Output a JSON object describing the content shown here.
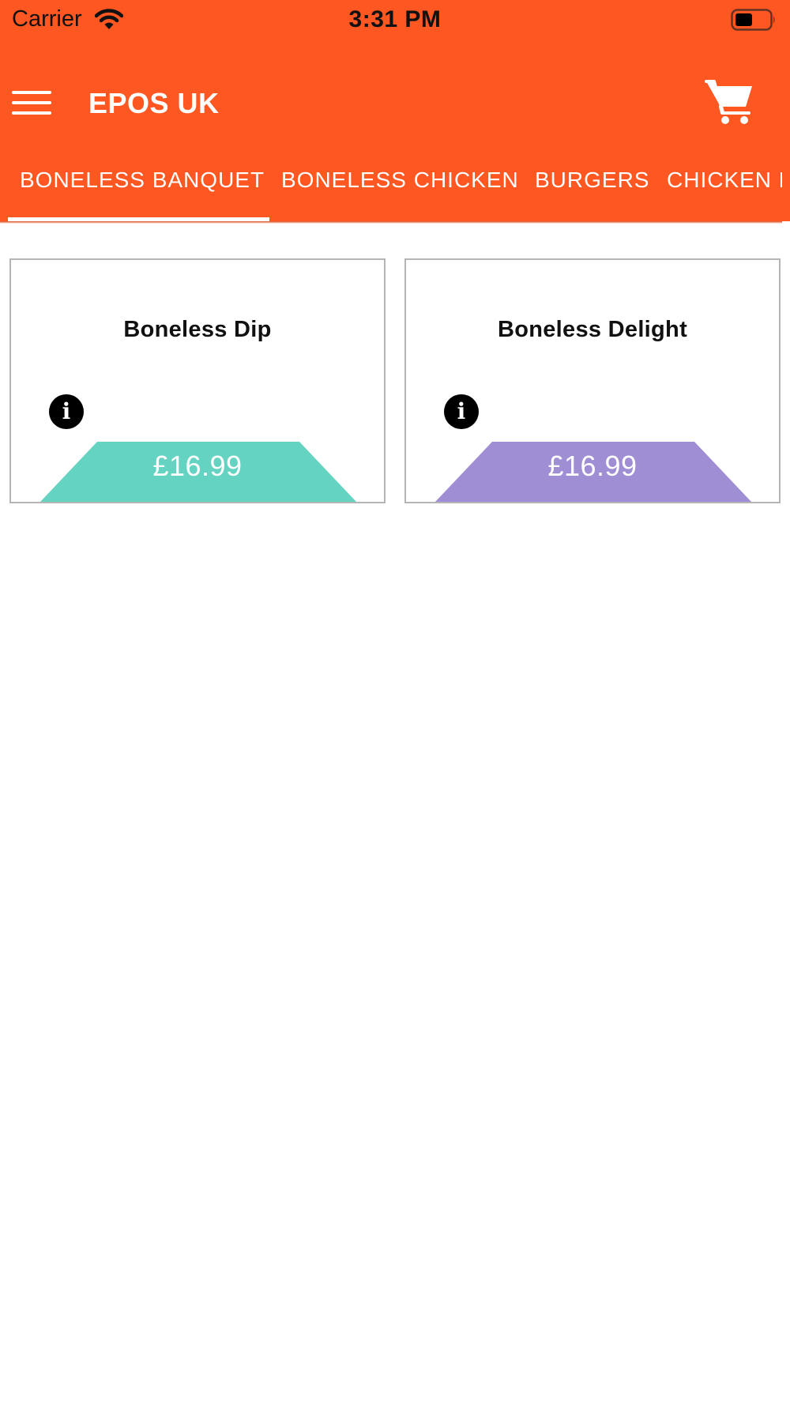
{
  "status_bar": {
    "carrier": "Carrier",
    "time": "3:31 PM",
    "wifi_icon": "wifi-icon",
    "battery_icon": "battery-icon"
  },
  "toolbar": {
    "menu_icon": "hamburger-menu-icon",
    "title": "EPOS UK",
    "cart_icon": "shopping-cart-icon",
    "background_color": "#FF5722"
  },
  "tabs": [
    {
      "label": "BONELESS BANQUET",
      "selected": true
    },
    {
      "label": "BONELESS CHICKEN",
      "selected": false
    },
    {
      "label": "BURGERS",
      "selected": false
    },
    {
      "label": "CHICKEN F",
      "selected": false
    }
  ],
  "products": [
    {
      "name": "Boneless Dip",
      "price": "£16.99",
      "info_icon": "info-icon",
      "price_color": "#64D3C1"
    },
    {
      "name": "Boneless Delight",
      "price": "£16.99",
      "info_icon": "info-icon",
      "price_color": "#A08ED4"
    }
  ]
}
